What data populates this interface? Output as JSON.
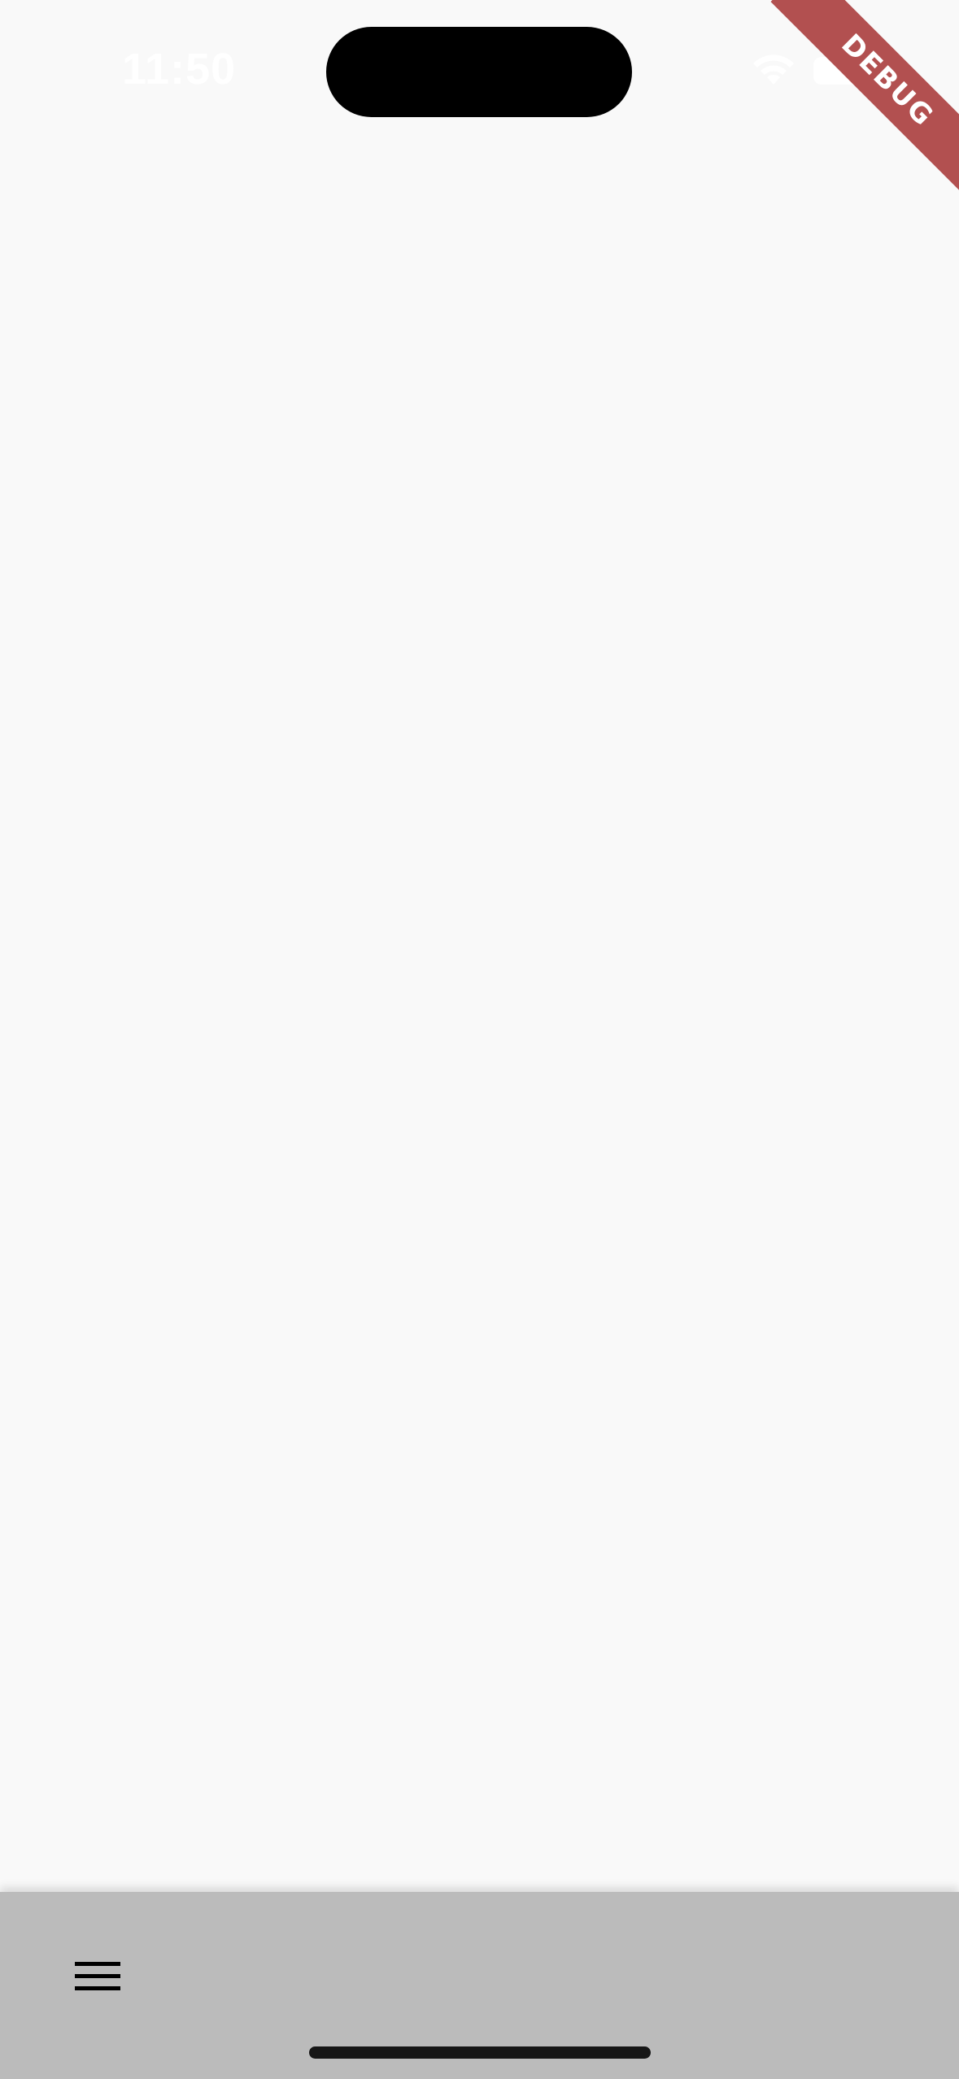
{
  "status_bar": {
    "time": "11:50",
    "wifi_icon": "wifi-icon",
    "battery_icon": "battery-icon"
  },
  "debug_banner": {
    "label": "DEBUG",
    "color": "#b25050"
  },
  "bottom_bar": {
    "menu_icon": "hamburger-menu-icon",
    "background": "#bbbbbb"
  },
  "colors": {
    "page_background": "#f9f9f9",
    "home_indicator": "#161616"
  }
}
